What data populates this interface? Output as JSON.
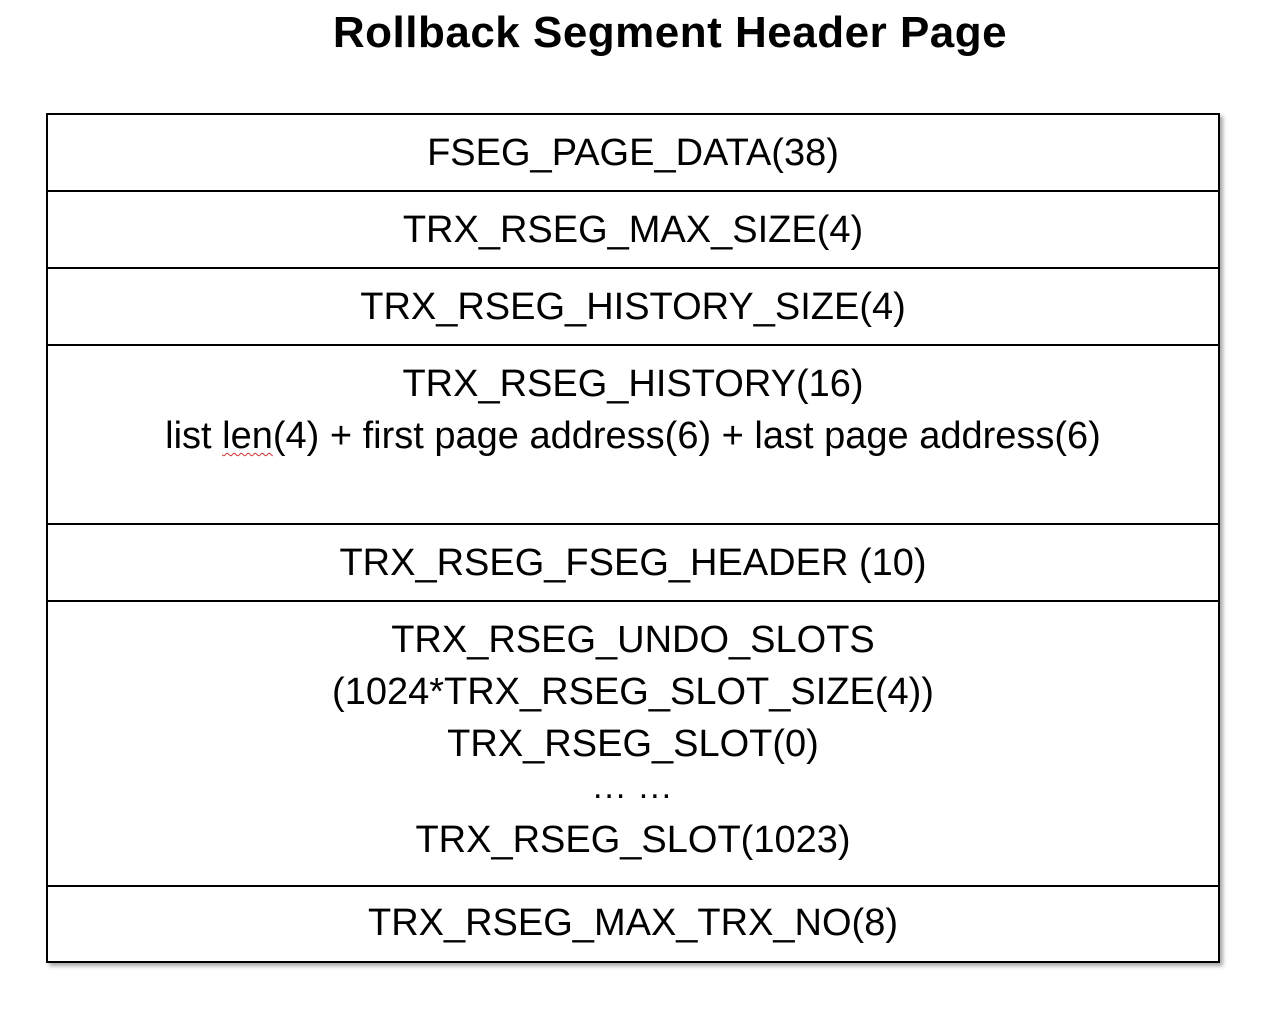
{
  "title": "Rollback Segment Header Page",
  "rows": [
    {
      "lines": [
        "FSEG_PAGE_DATA(38)"
      ]
    },
    {
      "lines": [
        "TRX_RSEG_MAX_SIZE(4)"
      ]
    },
    {
      "lines": [
        "TRX_RSEG_HISTORY_SIZE(4)"
      ]
    },
    {
      "line1": "TRX_RSEG_HISTORY(16)",
      "line2_pre": "list ",
      "line2_mark": "len",
      "line2_post": "(4) + first page address(6) + last page address(6)"
    },
    {
      "lines": [
        "TRX_RSEG_FSEG_HEADER (10)"
      ]
    },
    {
      "lines": [
        "TRX_RSEG_UNDO_SLOTS",
        "(1024*TRX_RSEG_SLOT_SIZE(4))",
        "TRX_RSEG_SLOT(0)",
        "... ...",
        "TRX_RSEG_SLOT(1023)"
      ]
    },
    {
      "lines": [
        "TRX_RSEG_MAX_TRX_NO(8)"
      ]
    }
  ]
}
